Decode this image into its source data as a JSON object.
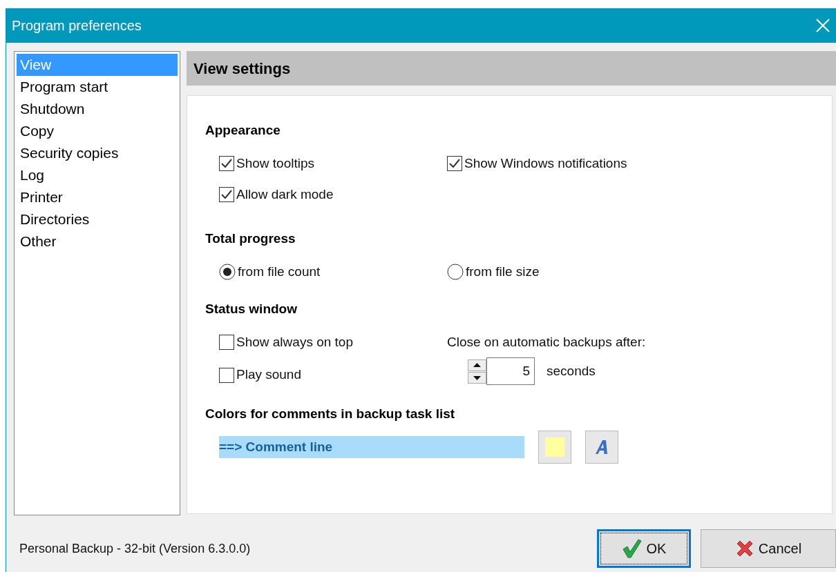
{
  "window": {
    "title": "Program preferences"
  },
  "sidebar": {
    "items": [
      {
        "label": "View",
        "selected": true
      },
      {
        "label": "Program start",
        "selected": false
      },
      {
        "label": "Shutdown",
        "selected": false
      },
      {
        "label": "Copy",
        "selected": false
      },
      {
        "label": "Security copies",
        "selected": false
      },
      {
        "label": "Log",
        "selected": false
      },
      {
        "label": "Printer",
        "selected": false
      },
      {
        "label": "Directories",
        "selected": false
      },
      {
        "label": "Other",
        "selected": false
      }
    ]
  },
  "header": {
    "title": "View settings"
  },
  "sections": [
    {
      "title": "Appearance",
      "controls": [
        {
          "kind": "checkbox",
          "label": "Show tooltips",
          "checked": true
        },
        {
          "kind": "checkbox",
          "label": "Show Windows notifications",
          "checked": true
        },
        {
          "kind": "checkbox",
          "label": "Allow dark mode",
          "checked": true
        }
      ]
    },
    {
      "title": "Total progress",
      "controls": [
        {
          "kind": "radio",
          "label": "from file count",
          "selected": true
        },
        {
          "kind": "radio",
          "label": "from file size",
          "selected": false
        }
      ]
    },
    {
      "title": "Status window",
      "controls": [
        {
          "kind": "checkbox",
          "label": "Show always on top",
          "checked": false
        },
        {
          "kind": "spin",
          "label": "Close on automatic backups after:",
          "value": "5",
          "unit": "seconds"
        },
        {
          "kind": "checkbox",
          "label": "Play sound",
          "checked": false
        }
      ]
    }
  ],
  "comment_colors": {
    "title": "Colors for comments in backup task list",
    "preview": "==> Comment line"
  },
  "footer": {
    "version": "Personal Backup - 32-bit (Version 6.3.0.0)"
  },
  "buttons": [
    {
      "kind": "ok",
      "label": "OK",
      "focused": true
    },
    {
      "kind": "cancel",
      "label": "Cancel",
      "focused": false
    }
  ]
}
